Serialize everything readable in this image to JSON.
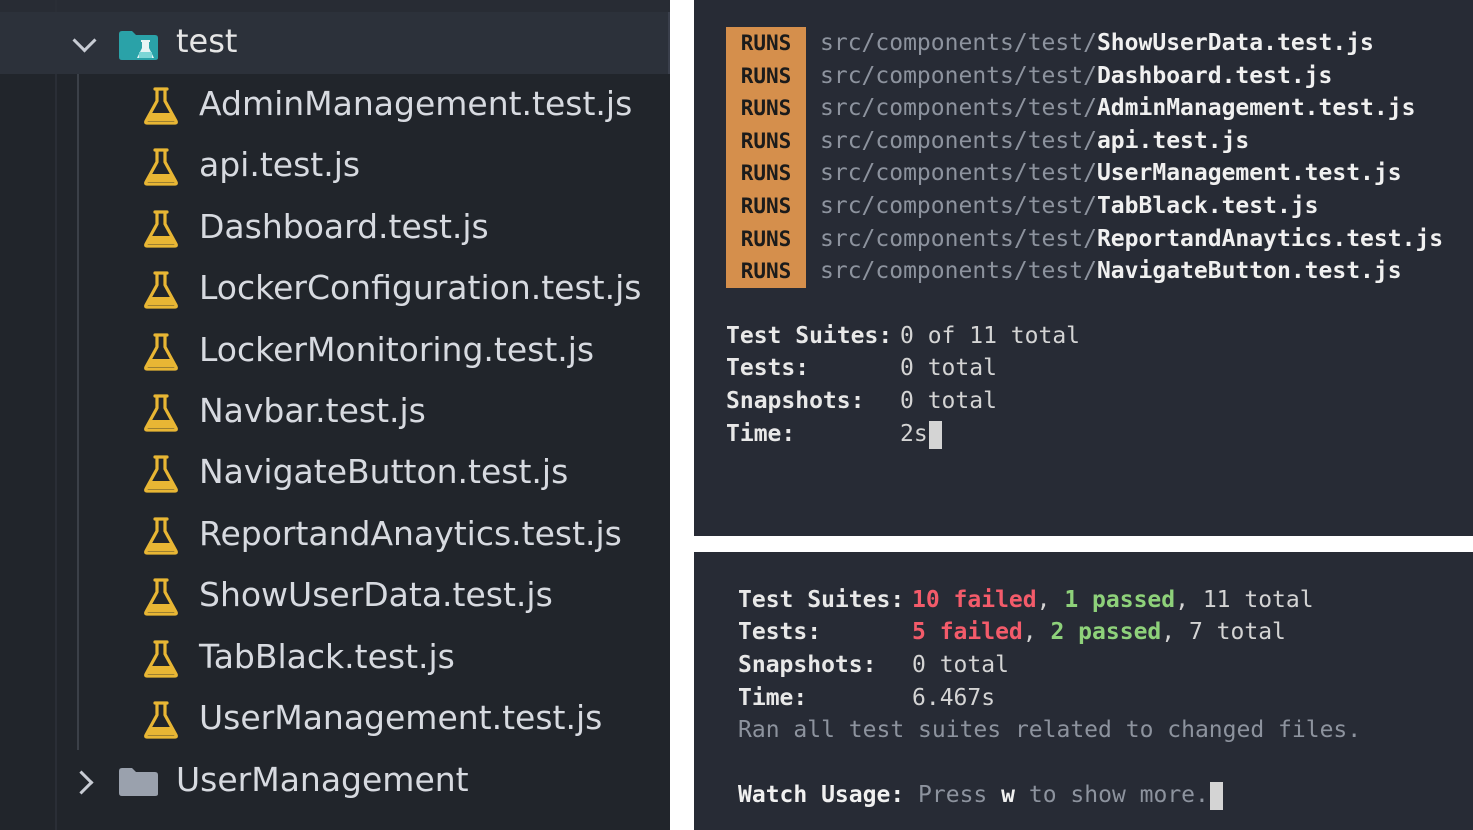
{
  "explorer": {
    "open_folder": {
      "label": "test",
      "icon": "test-folder-icon",
      "chevron": "chevron-down-icon"
    },
    "files": [
      {
        "name": "AdminManagement.test.js",
        "icon": "flask-icon"
      },
      {
        "name": "api.test.js",
        "icon": "flask-icon"
      },
      {
        "name": "Dashboard.test.js",
        "icon": "flask-icon"
      },
      {
        "name": "LockerConfiguration.test.js",
        "icon": "flask-icon"
      },
      {
        "name": "LockerMonitoring.test.js",
        "icon": "flask-icon"
      },
      {
        "name": "Navbar.test.js",
        "icon": "flask-icon"
      },
      {
        "name": "NavigateButton.test.js",
        "icon": "flask-icon"
      },
      {
        "name": "ReportandAnaytics.test.js",
        "icon": "flask-icon"
      },
      {
        "name": "ShowUserData.test.js",
        "icon": "flask-icon"
      },
      {
        "name": "TabBlack.test.js",
        "icon": "flask-icon"
      },
      {
        "name": "UserManagement.test.js",
        "icon": "flask-icon"
      }
    ],
    "closed_folder": {
      "label": "UserManagement",
      "icon": "folder-icon",
      "chevron": "chevron-right-icon"
    }
  },
  "terminal_running": {
    "badge": "RUNS",
    "path_prefix": "src/components/test/",
    "runs": [
      "ShowUserData.test.js",
      "Dashboard.test.js",
      "AdminManagement.test.js",
      "api.test.js",
      "UserManagement.test.js",
      "TabBlack.test.js",
      "ReportandAnaytics.test.js",
      "NavigateButton.test.js"
    ],
    "summary": {
      "suites_label": "Test Suites:",
      "suites_value": "0 of 11 total",
      "tests_label": "Tests:",
      "tests_value": "0 total",
      "snapshots_label": "Snapshots:",
      "snapshots_value": "0 total",
      "time_label": "Time:",
      "time_value": "2s"
    }
  },
  "terminal_result": {
    "suites_label": "Test Suites:",
    "suites_failed": "10 failed",
    "suites_passed": "1 passed",
    "suites_total": "11 total",
    "tests_label": "Tests:",
    "tests_failed": "5 failed",
    "tests_passed": "2 passed",
    "tests_total": "7 total",
    "snapshots_label": "Snapshots:",
    "snapshots_value": "0 total",
    "time_label": "Time:",
    "time_value": "6.467s",
    "ran_all": "Ran all test suites related to changed files.",
    "watch_label": "Watch Usage:",
    "watch_press": "Press",
    "watch_key": "w",
    "watch_rest": "to show more."
  },
  "colors": {
    "explorer_bg": "#21252b",
    "terminal_bg": "#272b35",
    "badge_bg": "#d58f4c",
    "failed": "#f35b6a",
    "passed": "#8ed17a",
    "flask": "#e8b634"
  }
}
